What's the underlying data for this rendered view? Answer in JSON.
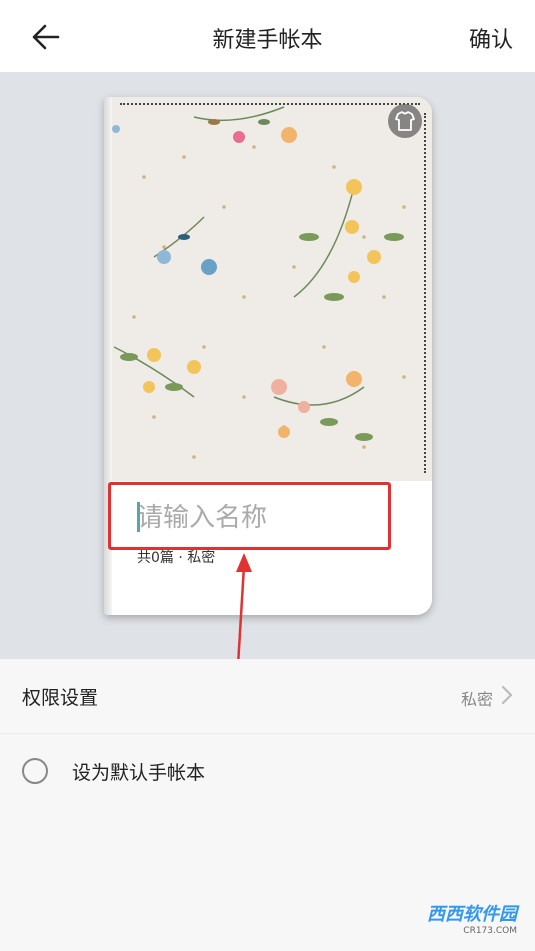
{
  "header": {
    "title": "新建手帐本",
    "confirm_label": "确认"
  },
  "cover": {
    "name_placeholder": "请输入名称",
    "meta_text": "共0篇 · 私密"
  },
  "settings": {
    "permission_label": "权限设置",
    "permission_value": "私密",
    "default_label": "设为默认手帐本"
  },
  "watermark": {
    "brand": "西西软件园",
    "url": "CR173.COM"
  },
  "colors": {
    "highlight_red": "#e03232",
    "cover_bg": "#efebe6",
    "page_bg": "#dfe2e6"
  }
}
